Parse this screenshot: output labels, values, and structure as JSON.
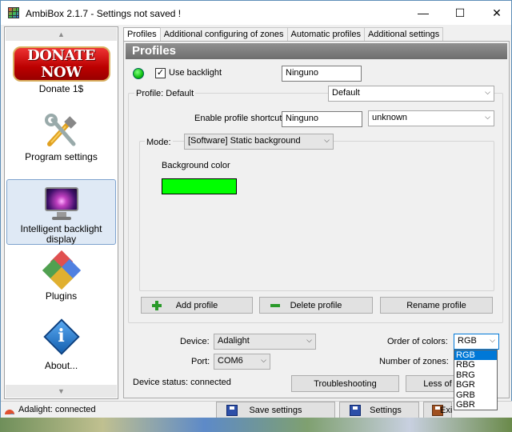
{
  "window": {
    "title": "AmbiBox 2.1.7  - Settings not saved !",
    "minimize": "—",
    "maximize": "☐",
    "close": "✕"
  },
  "sidebar": {
    "scroll_up": "▲",
    "scroll_down": "▼",
    "items": [
      {
        "label": "Donate 1$",
        "badge": "DONATE NOW",
        "icon": "donate-badge-icon"
      },
      {
        "label": "Program settings",
        "icon": "tools-icon"
      },
      {
        "label": "Intelligent backlight display",
        "icon": "monitor-icon",
        "active": true
      },
      {
        "label": "Plugins",
        "icon": "puzzle-icon"
      },
      {
        "label": "About...",
        "icon": "info-icon",
        "glyph": "i"
      }
    ]
  },
  "tabs": [
    "Profiles",
    "Additional configuring of zones",
    "Automatic profiles",
    "Additional settings"
  ],
  "profiles": {
    "header": "Profiles",
    "use_backlight_label": "Use backlight",
    "use_backlight_checked": "✓",
    "use_backlight_value": "Ninguno",
    "profile_label": "Profile: Default",
    "profile_select": "Default",
    "shortcut_label": "Enable profile shortcut:",
    "shortcut_value": "Ninguno",
    "shortcut_key": "unknown",
    "mode_label": "Mode:",
    "mode_select": "[Software] Static background",
    "background_color_label": "Background color",
    "background_color": "#00ff00",
    "add_profile": "Add profile",
    "delete_profile": "Delete profile",
    "rename_profile": "Rename profile"
  },
  "device": {
    "device_label": "Device:",
    "device_value": "Adalight",
    "port_label": "Port:",
    "port_value": "COM6",
    "order_label": "Order of colors:",
    "order_value": "RGB",
    "order_options": [
      "RGB",
      "RBG",
      "BRG",
      "BGR",
      "GRB",
      "GBR"
    ],
    "zones_label": "Number of zones:",
    "status_label": "Device status: connected",
    "troubleshooting": "Troubleshooting",
    "less_of": "Less of"
  },
  "statusbar": {
    "status_text": "Adalight: connected",
    "save_settings": "Save settings",
    "settings": "Settings",
    "exit_partial": "Exi"
  }
}
